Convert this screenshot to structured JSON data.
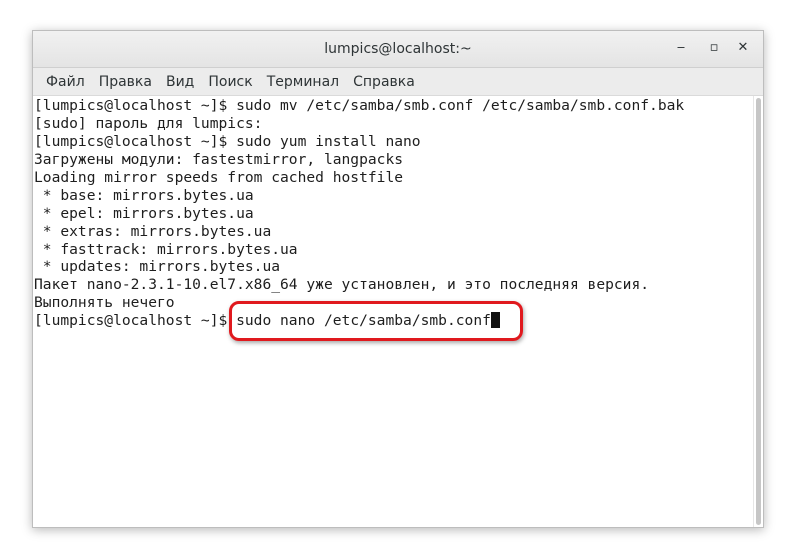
{
  "window": {
    "title": "lumpics@localhost:~",
    "minimize_label": "‒",
    "maximize_label": "▫",
    "close_label": "✕"
  },
  "menu": [
    "Файл",
    "Правка",
    "Вид",
    "Поиск",
    "Терминал",
    "Справка"
  ],
  "terminal": {
    "lines": [
      "[lumpics@localhost ~]$ sudo mv /etc/samba/smb.conf /etc/samba/smb.conf.bak",
      "[sudo] пароль для lumpics:",
      "[lumpics@localhost ~]$ sudo yum install nano",
      "Загружены модули: fastestmirror, langpacks",
      "Loading mirror speeds from cached hostfile",
      " * base: mirrors.bytes.ua",
      " * epel: mirrors.bytes.ua",
      " * extras: mirrors.bytes.ua",
      " * fasttrack: mirrors.bytes.ua",
      " * updates: mirrors.bytes.ua",
      "Пакет nano-2.3.1-10.el7.x86_64 уже установлен, и это последняя версия.",
      "Выполнять нечего"
    ],
    "prompt": "[lumpics@localhost ~]$ ",
    "current_command": "sudo nano /etc/samba/smb.conf"
  },
  "colors": {
    "highlight": "#e0191e"
  }
}
